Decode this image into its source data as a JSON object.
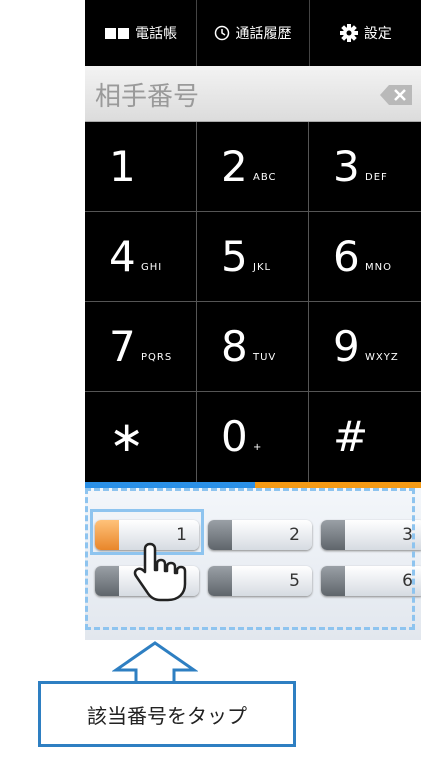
{
  "tabs": [
    {
      "label": "電話帳",
      "icon": "book-icon"
    },
    {
      "label": "通話履歴",
      "icon": "clock-icon"
    },
    {
      "label": "設定",
      "icon": "gear-icon"
    }
  ],
  "number_bar": {
    "placeholder": "相手番号",
    "delete_icon": "backspace-icon"
  },
  "keypad": [
    {
      "digit": "1",
      "letters": ""
    },
    {
      "digit": "2",
      "letters": "ABC"
    },
    {
      "digit": "3",
      "letters": "DEF"
    },
    {
      "digit": "4",
      "letters": "GHI"
    },
    {
      "digit": "5",
      "letters": "JKL"
    },
    {
      "digit": "6",
      "letters": "MNO"
    },
    {
      "digit": "7",
      "letters": "PQRS"
    },
    {
      "digit": "8",
      "letters": "TUV"
    },
    {
      "digit": "9",
      "letters": "WXYZ"
    },
    {
      "digit": "∗",
      "letters": ""
    },
    {
      "digit": "0",
      "letters": "+"
    },
    {
      "digit": "#",
      "letters": ""
    }
  ],
  "speed_dial": [
    "1",
    "2",
    "3",
    "",
    "5",
    "6"
  ],
  "callout": {
    "text": "該当番号をタップ"
  },
  "colors": {
    "accent_blue": "#2a8fe6",
    "accent_orange": "#f39a16",
    "dash": "#8ec4ef",
    "callout_border": "#2e7fc2"
  }
}
